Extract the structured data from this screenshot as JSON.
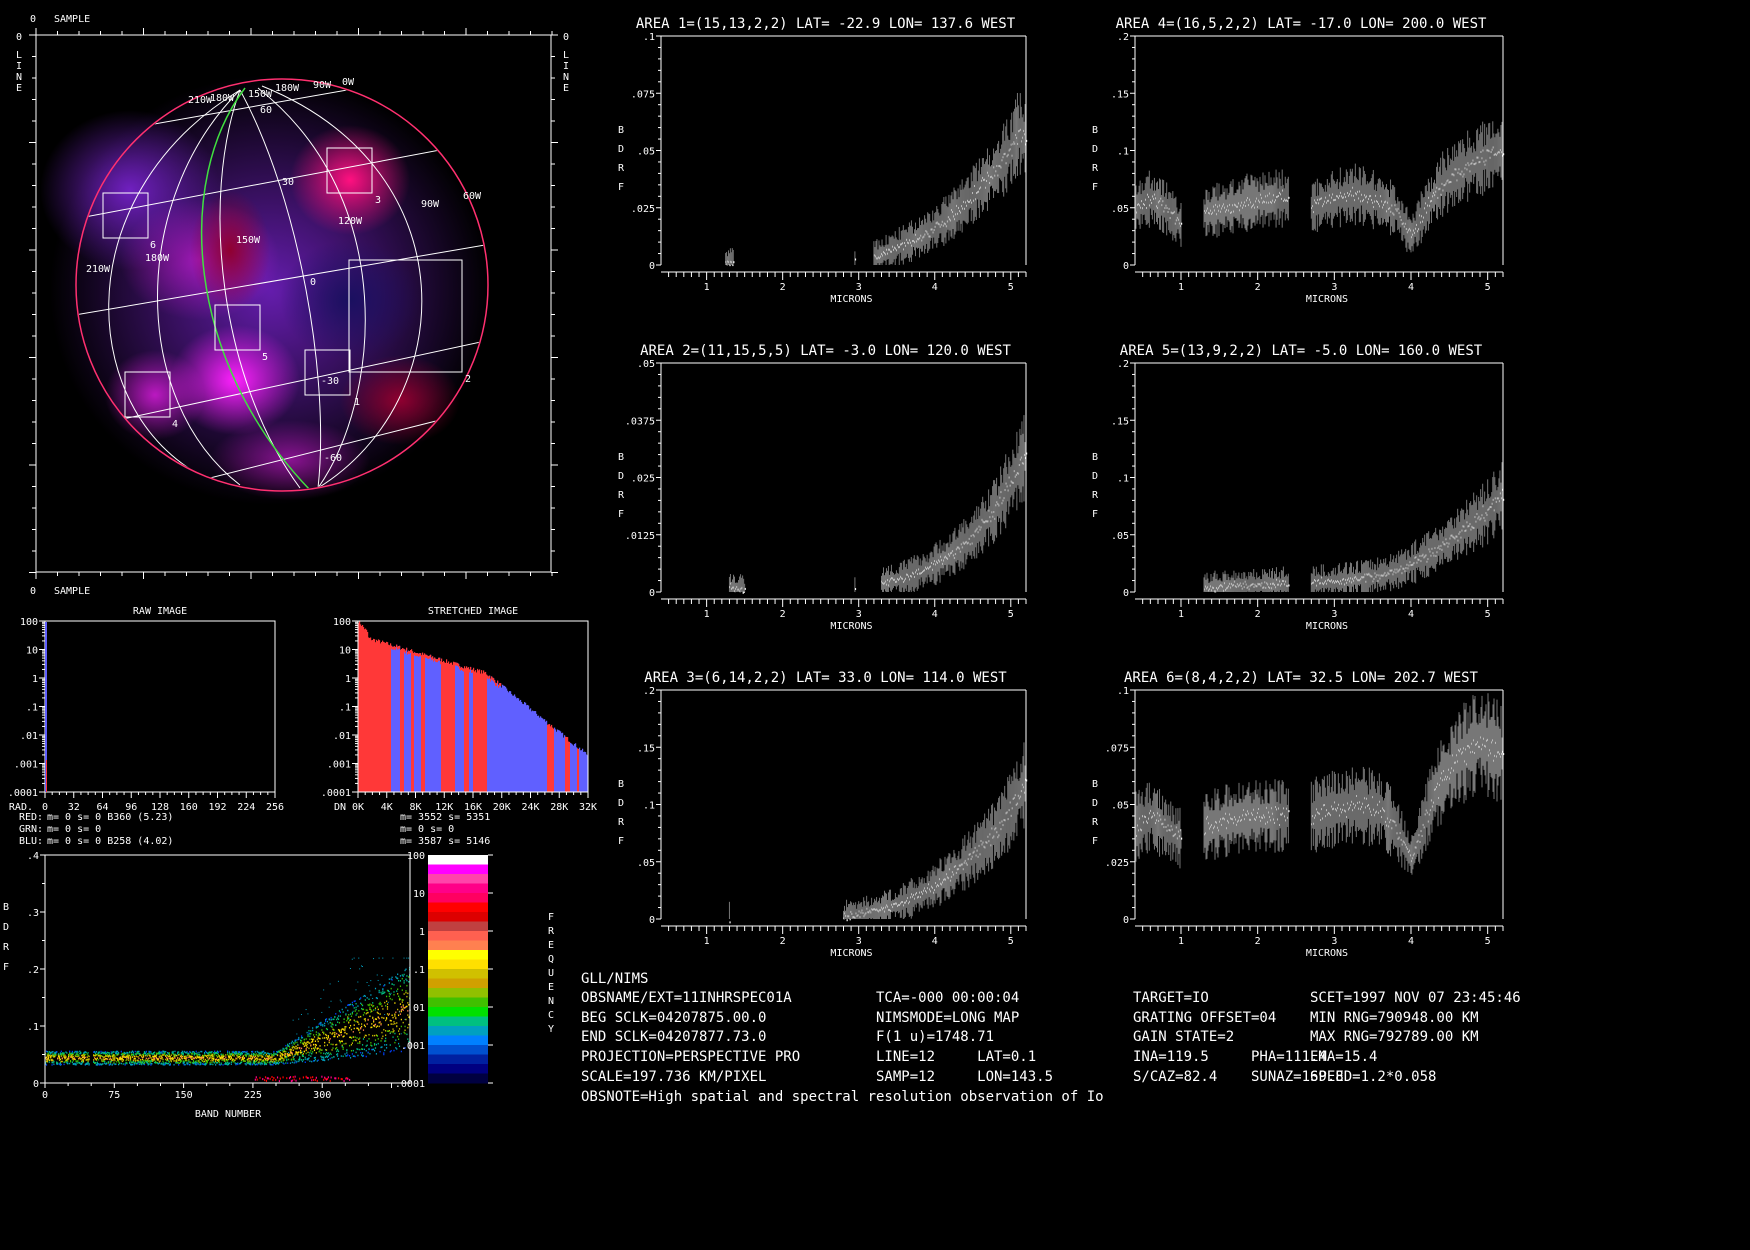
{
  "image_panel": {
    "origin_label": "0",
    "sample_label": "SAMPLE",
    "line_label": "LINE",
    "boxes": [
      "1",
      "2",
      "3",
      "4",
      "5",
      "6"
    ],
    "grid_labels": [
      "210W",
      "180W",
      "150W",
      "180W",
      "90W",
      "0W",
      "60",
      "30",
      "3",
      "90W",
      "60W",
      "120W",
      "150W",
      "180W",
      "6",
      "210W",
      "0",
      "5",
      "-30",
      "1",
      "4",
      "-60",
      "2"
    ]
  },
  "raw_hist": {
    "title": "RAW IMAGE",
    "y_ticks": [
      "100",
      "10",
      "1",
      ".1",
      ".01",
      ".001",
      ".0001"
    ],
    "x_axis_label": "RAD.",
    "x_ticks": [
      "0",
      "32",
      "64",
      "96",
      "128",
      "160",
      "192",
      "224",
      "256"
    ],
    "stats": [
      {
        "label": "RED:",
        "color": "#ff2020",
        "text": "m=    0 s=    0 B360 (5.23)"
      },
      {
        "label": "GRN:",
        "color": "#e8e890",
        "text": "m=    0 s=    0"
      },
      {
        "label": "BLU:",
        "color": "#6060ff",
        "text": "m=    0 s=    0 B258 (4.02)"
      }
    ]
  },
  "stretched_hist": {
    "title": "STRETCHED IMAGE",
    "y_ticks": [
      "100",
      "10",
      "1",
      ".1",
      ".01",
      ".001",
      ".0001"
    ],
    "x_axis_label": "DN",
    "x_ticks": [
      "0K",
      "4K",
      "8K",
      "12K",
      "16K",
      "20K",
      "24K",
      "28K",
      "32K"
    ],
    "stats": [
      "m= 3552 s= 5351",
      "m=    0 s=    0",
      "m= 3587 s= 5146"
    ],
    "red": "#ff3838",
    "blue": "#6060ff"
  },
  "density_plot": {
    "ylabel": "BDRF",
    "xlabel": "BAND NUMBER",
    "y_ticks": [
      "0",
      ".1",
      ".2",
      ".3",
      ".4"
    ],
    "x_ticks": [
      "0",
      "75",
      "150",
      "225",
      "300"
    ],
    "colorbar_label": "FREQUENCY",
    "colorbar_ticks": [
      "100",
      "10",
      "1",
      ".1",
      ".01",
      ".001",
      ".0001"
    ],
    "colorbar_colors": [
      "#ffffff",
      "#ff00ff",
      "#ff44aa",
      "#ff0088",
      "#ff0060",
      "#ff0000",
      "#dd0000",
      "#c04040",
      "#ff6050",
      "#ff8050",
      "#ffff00",
      "#ffe000",
      "#d0c000",
      "#d0a000",
      "#90c000",
      "#40c000",
      "#00e000",
      "#00c080",
      "#00a0c0",
      "#0080ff",
      "#0050d0",
      "#0020a0",
      "#000080",
      "#000040"
    ]
  },
  "spectra": [
    {
      "title": "AREA 1=(15,13,2,2) LAT= -22.9 LON= 137.6 WEST",
      "y_ticks": [
        "0",
        ".025",
        ".05",
        ".075",
        ".1"
      ],
      "ymax": 0.1,
      "points": [
        [
          1.25,
          0.001
        ],
        [
          1.35,
          0.001
        ],
        null,
        [
          2.95,
          0.002
        ],
        null,
        [
          3.2,
          0.003
        ],
        [
          3.4,
          0.006
        ],
        [
          3.6,
          0.009
        ],
        [
          3.8,
          0.012
        ],
        [
          4.0,
          0.016
        ],
        [
          4.2,
          0.021
        ],
        [
          4.4,
          0.027
        ],
        [
          4.6,
          0.034
        ],
        [
          4.8,
          0.041
        ],
        [
          5.0,
          0.05
        ],
        [
          5.1,
          0.058
        ],
        [
          5.2,
          0.055
        ]
      ]
    },
    {
      "title": "AREA 4=(16,5,2,2) LAT= -17.0 LON= 200.0 WEST",
      "y_ticks": [
        "0",
        ".05",
        ".1",
        ".15",
        ".2"
      ],
      "ymax": 0.2,
      "points": [
        [
          0.4,
          0.05
        ],
        [
          0.6,
          0.058
        ],
        [
          0.8,
          0.05
        ],
        [
          1.0,
          0.035
        ],
        null,
        [
          1.3,
          0.045
        ],
        [
          1.6,
          0.05
        ],
        [
          1.9,
          0.055
        ],
        [
          2.2,
          0.058
        ],
        [
          2.4,
          0.058
        ],
        null,
        [
          2.7,
          0.05
        ],
        [
          3.0,
          0.058
        ],
        [
          3.3,
          0.062
        ],
        [
          3.6,
          0.055
        ],
        [
          3.8,
          0.048
        ],
        [
          4.0,
          0.025
        ],
        [
          4.2,
          0.05
        ],
        [
          4.4,
          0.07
        ],
        [
          4.7,
          0.085
        ],
        [
          5.0,
          0.095
        ],
        [
          5.2,
          0.1
        ]
      ]
    },
    {
      "title": "AREA 2=(11,15,5,5) LAT=  -3.0 LON= 120.0 WEST",
      "y_ticks": [
        "0",
        ".0125",
        ".025",
        ".0375",
        ".05"
      ],
      "ymax": 0.05,
      "points": [
        [
          1.3,
          0.001
        ],
        [
          1.5,
          0.0005
        ],
        null,
        [
          2.95,
          0.001
        ],
        null,
        [
          3.3,
          0.002
        ],
        [
          3.6,
          0.003
        ],
        [
          3.9,
          0.005
        ],
        [
          4.2,
          0.008
        ],
        [
          4.5,
          0.012
        ],
        [
          4.8,
          0.018
        ],
        [
          5.0,
          0.024
        ],
        [
          5.2,
          0.03
        ]
      ]
    },
    {
      "title": "AREA 5=(13,9,2,2) LAT=  -5.0 LON= 160.0 WEST",
      "y_ticks": [
        "0",
        ".05",
        ".1",
        ".15",
        ".2"
      ],
      "ymax": 0.2,
      "points": [
        [
          1.3,
          0.003
        ],
        [
          1.6,
          0.005
        ],
        [
          2.0,
          0.006
        ],
        [
          2.4,
          0.007
        ],
        null,
        [
          2.7,
          0.008
        ],
        [
          3.0,
          0.009
        ],
        [
          3.5,
          0.013
        ],
        [
          3.8,
          0.018
        ],
        [
          4.1,
          0.028
        ],
        [
          4.4,
          0.04
        ],
        [
          4.7,
          0.055
        ],
        [
          5.0,
          0.07
        ],
        [
          5.2,
          0.085
        ]
      ]
    },
    {
      "title": "AREA 3=(6,14,2,2) LAT=  33.0 LON= 114.0 WEST",
      "y_ticks": [
        "0",
        ".05",
        ".1",
        ".15",
        ".2"
      ],
      "ymax": 0.2,
      "points": [
        [
          1.3,
          0.001
        ],
        null,
        [
          2.8,
          0.002
        ],
        [
          3.0,
          0.004
        ],
        [
          3.3,
          0.008
        ],
        [
          3.6,
          0.015
        ],
        [
          3.9,
          0.025
        ],
        [
          4.2,
          0.038
        ],
        [
          4.5,
          0.055
        ],
        [
          4.8,
          0.075
        ],
        [
          5.0,
          0.095
        ],
        [
          5.2,
          0.12
        ]
      ]
    },
    {
      "title": "AREA 6=(8,4,2,2) LAT=  32.5 LON= 202.7 WEST",
      "y_ticks": [
        "0",
        ".025",
        ".05",
        ".075",
        ".1"
      ],
      "ymax": 0.1,
      "points": [
        [
          0.4,
          0.04
        ],
        [
          0.6,
          0.045
        ],
        [
          0.8,
          0.04
        ],
        [
          1.0,
          0.035
        ],
        null,
        [
          1.3,
          0.04
        ],
        [
          1.6,
          0.043
        ],
        [
          1.9,
          0.045
        ],
        [
          2.2,
          0.045
        ],
        [
          2.4,
          0.045
        ],
        null,
        [
          2.7,
          0.045
        ],
        [
          3.0,
          0.048
        ],
        [
          3.3,
          0.05
        ],
        [
          3.6,
          0.048
        ],
        [
          3.8,
          0.04
        ],
        [
          4.0,
          0.027
        ],
        [
          4.1,
          0.035
        ],
        [
          4.3,
          0.055
        ],
        [
          4.6,
          0.07
        ],
        [
          4.9,
          0.078
        ],
        [
          5.2,
          0.072
        ]
      ]
    }
  ],
  "spectra_axes": {
    "xlabel": "MICRONS",
    "ylabel": "BDRF",
    "x_ticks": [
      "1",
      "2",
      "3",
      "4",
      "5"
    ]
  },
  "info": {
    "header": "GLL/NIMS",
    "rows": [
      [
        "OBSNAME/EXT=11INHRSPEC01A",
        "TCA=-000 00:00:04",
        "TARGET=IO",
        "SCET=1997 NOV 07 23:45:46"
      ],
      [
        "BEG SCLK=04207875.00.0",
        "NIMSMODE=LONG MAP",
        "GRATING OFFSET=04",
        "MIN RNG=790948.00 KM"
      ],
      [
        "END SCLK=04207877.73.0",
        "F(1 u)=1748.71",
        "GAIN STATE=2",
        "MAX RNG=792789.00 KM"
      ],
      [
        "PROJECTION=PERSPECTIVE PRO",
        "LINE=12     LAT=0.1",
        "INA=119.5     PHA=111.4",
        "EMA=15.4"
      ],
      [
        "SCALE=197.736 KM/PIXEL",
        "SAMP=12     LON=143.5",
        "S/CAZ=82.4    SUNAZ=169.8",
        "SPEED=1.2*0.058"
      ]
    ],
    "note": "OBSNOTE=High spatial and spectral resolution observation of Io"
  }
}
